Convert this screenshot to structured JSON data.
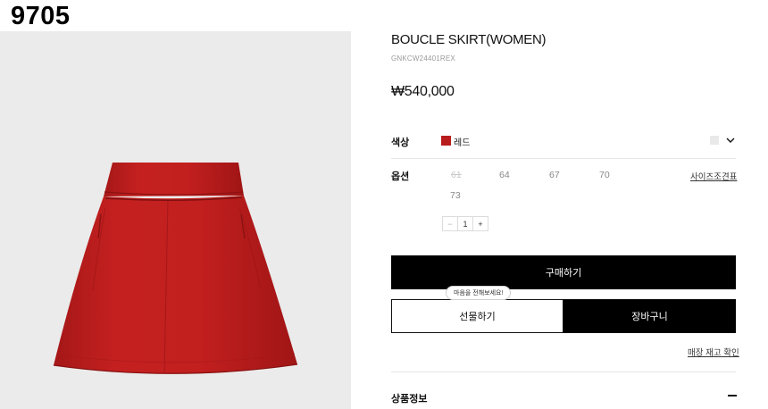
{
  "brand": "9705",
  "product": {
    "title": "BOUCLE SKIRT(WOMEN)",
    "code": "GNKCW24401REX",
    "price": "₩540,000"
  },
  "color": {
    "label": "색상",
    "name": "레드",
    "swatch": "#b81c1c"
  },
  "option": {
    "label": "옵션",
    "sizes": [
      {
        "label": "61",
        "sold_out": true
      },
      {
        "label": "64",
        "sold_out": false
      },
      {
        "label": "67",
        "sold_out": false
      },
      {
        "label": "70",
        "sold_out": false
      },
      {
        "label": "73",
        "sold_out": false
      }
    ],
    "size_chart": "사이즈조견표"
  },
  "quantity": {
    "minus": "−",
    "value": "1",
    "plus": "+"
  },
  "buttons": {
    "buy": "구매하기",
    "gift": "선물하기",
    "cart": "장바구니",
    "gift_tooltip": "마음을 전해보세요!"
  },
  "store_stock": "매장 재고 확인",
  "product_info": "상품정보"
}
